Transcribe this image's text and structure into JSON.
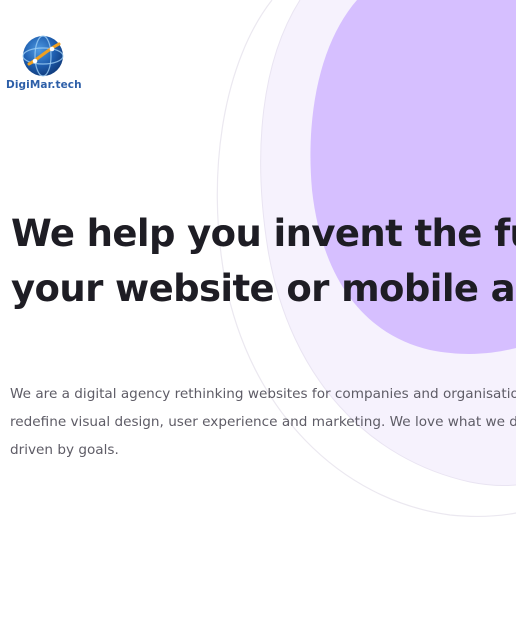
{
  "brand": {
    "logo_text_part1": "DigiMar",
    "logo_text_part2": ".tech",
    "logo_icon": "globe-icon"
  },
  "hero": {
    "headline_line1": "We help you invent the futur",
    "headline_line2": "your website or mobile app",
    "body_line1": "We are a digital agency rethinking websites for companies and organisatio",
    "body_line2": "redefine visual design, user experience and marketing. We love what we do",
    "body_line3": "driven by goals."
  },
  "colors": {
    "accent_purple": "#d6bfff",
    "heading": "#1e1d24",
    "body": "#5e5c66",
    "brand_blue": "#2d5fa8"
  }
}
